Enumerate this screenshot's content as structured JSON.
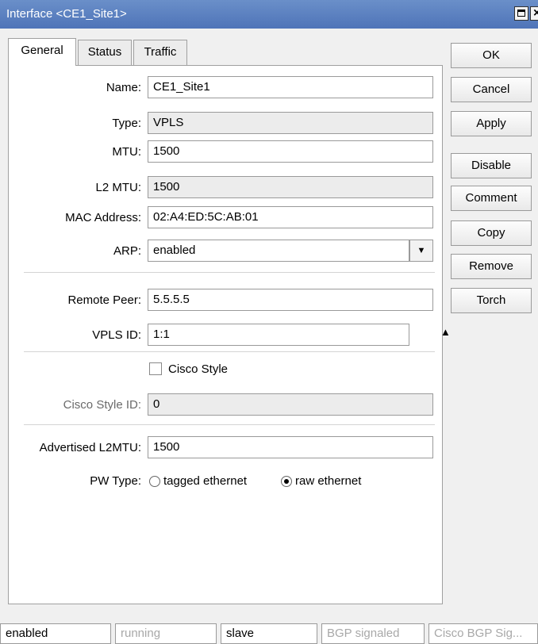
{
  "window": {
    "title": "Interface <CE1_Site1>"
  },
  "tabs": [
    {
      "label": "General",
      "active": true
    },
    {
      "label": "Status",
      "active": false
    },
    {
      "label": "Traffic",
      "active": false
    }
  ],
  "form": {
    "name": {
      "label": "Name:",
      "value": "CE1_Site1"
    },
    "type": {
      "label": "Type:",
      "value": "VPLS"
    },
    "mtu": {
      "label": "MTU:",
      "value": "1500"
    },
    "l2mtu": {
      "label": "L2 MTU:",
      "value": "1500"
    },
    "mac": {
      "label": "MAC Address:",
      "value": "02:A4:ED:5C:AB:01"
    },
    "arp": {
      "label": "ARP:",
      "value": "enabled"
    },
    "remote_peer": {
      "label": "Remote Peer:",
      "value": "5.5.5.5"
    },
    "vpls_id": {
      "label": "VPLS ID:",
      "value": "1:1"
    },
    "cisco_style": {
      "label": "Cisco Style",
      "checked": false
    },
    "cisco_style_id": {
      "label": "Cisco Style ID:",
      "value": "0"
    },
    "advertised_l2mtu": {
      "label": "Advertised L2MTU:",
      "value": "1500"
    },
    "pw_type": {
      "label": "PW Type:",
      "options": [
        "tagged ethernet",
        "raw ethernet"
      ],
      "selected": "raw ethernet"
    }
  },
  "buttons": {
    "ok": "OK",
    "cancel": "Cancel",
    "apply": "Apply",
    "disable": "Disable",
    "comment": "Comment",
    "copy": "Copy",
    "remove": "Remove",
    "torch": "Torch"
  },
  "statusbar": [
    "enabled",
    "running",
    "slave",
    "BGP signaled",
    "Cisco BGP Sig..."
  ]
}
